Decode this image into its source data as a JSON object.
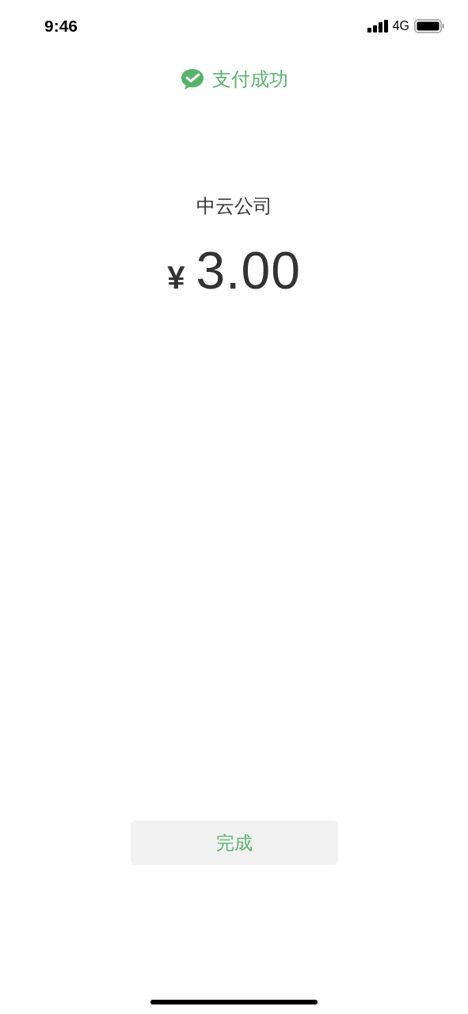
{
  "status_bar": {
    "time": "9:46",
    "network": "4G"
  },
  "header": {
    "title": "支付成功"
  },
  "payee": "中云公司",
  "amount": {
    "currency": "¥",
    "value": "3.00"
  },
  "done_button": {
    "label": "完成"
  }
}
